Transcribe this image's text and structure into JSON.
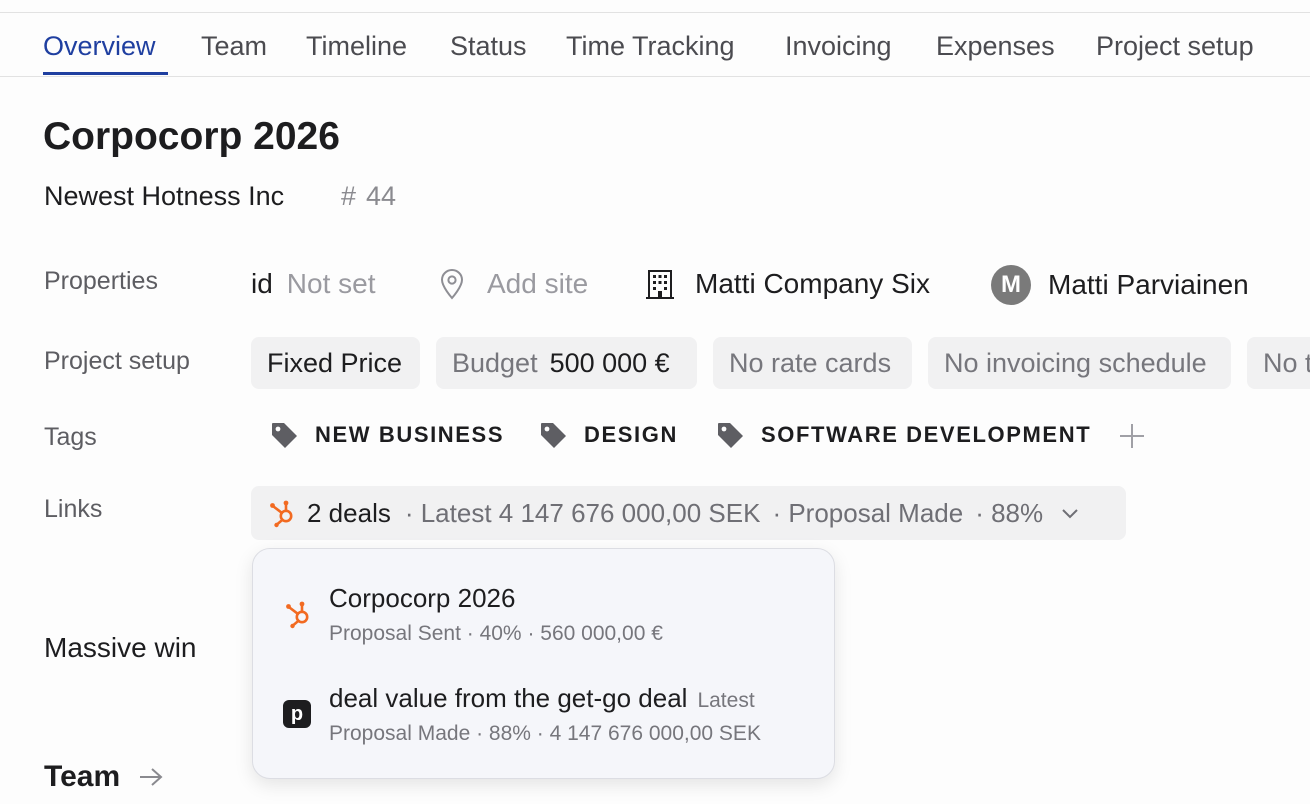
{
  "tabs": [
    {
      "label": "Overview",
      "active": true
    },
    {
      "label": "Team"
    },
    {
      "label": "Timeline"
    },
    {
      "label": "Status"
    },
    {
      "label": "Time Tracking"
    },
    {
      "label": "Invoicing"
    },
    {
      "label": "Expenses"
    },
    {
      "label": "Project setup"
    }
  ],
  "project": {
    "title": "Corpocorp 2026",
    "client": "Newest Hotness Inc",
    "hash_symbol": "#",
    "number": "44"
  },
  "properties": {
    "label": "Properties",
    "id_label": "id",
    "id_value": "Not set",
    "site": "Add site",
    "company": "Matti Company Six",
    "owner_initial": "M",
    "owner": "Matti Parviainen"
  },
  "setup": {
    "label": "Project setup",
    "pricing": "Fixed Price",
    "budget_label": "Budget",
    "budget_value": "500 000 €",
    "rate_cards": "No rate cards",
    "invoicing_schedule": "No invoicing schedule",
    "truncated": "No t"
  },
  "tags": {
    "label": "Tags",
    "items": [
      "NEW BUSINESS",
      "DESIGN",
      "SOFTWARE DEVELOPMENT"
    ]
  },
  "links": {
    "label": "Links",
    "deals": "2 deals",
    "latest": "· Latest 4 147 676 000,00 SEK",
    "stage": "· Proposal Made",
    "probability": "· 88%"
  },
  "popover": {
    "deals": [
      {
        "title": "Corpocorp 2026",
        "subtitle": "Proposal Sent · 40% · 560 000,00 €",
        "source": "hubspot-icon"
      },
      {
        "title": "deal value from the get-go deal",
        "badge": "Latest",
        "subtitle": "Proposal Made · 88% · 4 147 676 000,00 SEK",
        "source": "pipedrive-icon",
        "icon_letter": "p"
      }
    ]
  },
  "description": "Massive win",
  "team_section": {
    "title": "Team"
  },
  "colors": {
    "accent": "#1f3fa0",
    "hubspot": "#f26a21"
  }
}
